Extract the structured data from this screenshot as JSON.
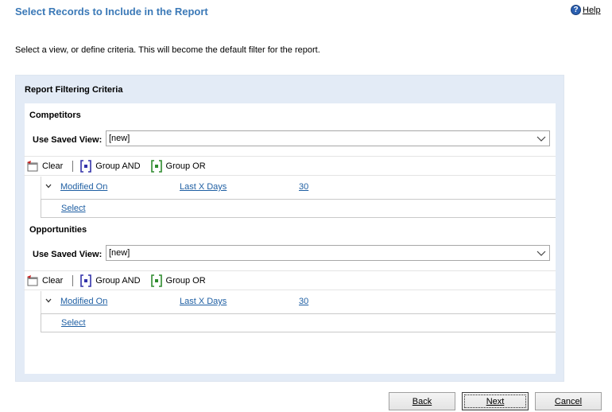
{
  "header": {
    "title": "Select Records to Include in the Report",
    "help_label": "Help"
  },
  "instruction": "Select a view, or define criteria. This will become the default filter for the report.",
  "panel": {
    "title": "Report Filtering Criteria",
    "sections": [
      {
        "name": "Competitors",
        "saved_view_label": "Use Saved View:",
        "saved_view_value": "[new]",
        "toolbar": {
          "clear": "Clear",
          "group_and": "Group AND",
          "group_or": "Group OR"
        },
        "criteria": {
          "field": "Modified On",
          "operator": "Last X Days",
          "value": "30"
        },
        "select_link": "Select"
      },
      {
        "name": "Opportunities",
        "saved_view_label": "Use Saved View:",
        "saved_view_value": "[new]",
        "toolbar": {
          "clear": "Clear",
          "group_and": "Group AND",
          "group_or": "Group OR"
        },
        "criteria": {
          "field": "Modified On",
          "operator": "Last X Days",
          "value": "30"
        },
        "select_link": "Select"
      }
    ]
  },
  "buttons": {
    "back": "Back",
    "next": "Next",
    "cancel": "Cancel"
  },
  "colors": {
    "title": "#3b79b7",
    "panel_bg": "#e3ebf6",
    "link": "#1f5fa3",
    "group_and_icon": "#3333aa",
    "group_or_icon": "#2e8b2e",
    "clear_icon": "#cc2222"
  }
}
